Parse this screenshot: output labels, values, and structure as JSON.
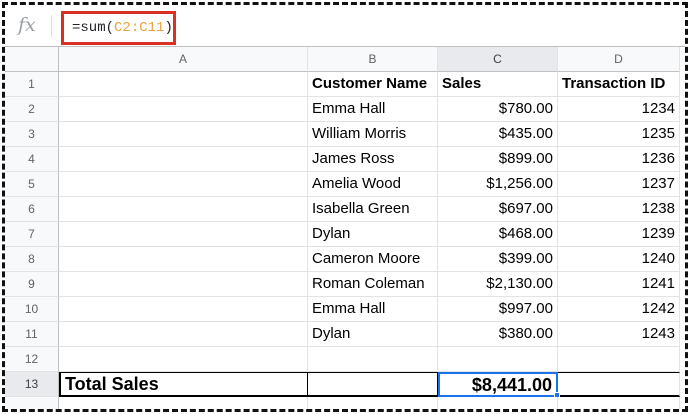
{
  "formula_bar": {
    "fx_label": "fx",
    "formula_prefix": "=sum(",
    "formula_range": "C2:C11",
    "formula_suffix": ")"
  },
  "columns": [
    "A",
    "B",
    "C",
    "D"
  ],
  "selected_column": "C",
  "selected_row": "13",
  "headers": {
    "customer_name": "Customer Name",
    "sales": "Sales",
    "transaction_id": "Transaction ID"
  },
  "rows": [
    {
      "num": "2",
      "name": "Emma Hall",
      "sales": "$780.00",
      "tid": "1234"
    },
    {
      "num": "3",
      "name": "William Morris",
      "sales": "$435.00",
      "tid": "1235"
    },
    {
      "num": "4",
      "name": "James Ross",
      "sales": "$899.00",
      "tid": "1236"
    },
    {
      "num": "5",
      "name": "Amelia Wood",
      "sales": "$1,256.00",
      "tid": "1237"
    },
    {
      "num": "6",
      "name": "Isabella Green",
      "sales": "$697.00",
      "tid": "1238"
    },
    {
      "num": "7",
      "name": "Dylan",
      "sales": "$468.00",
      "tid": "1239"
    },
    {
      "num": "8",
      "name": "Cameron Moore",
      "sales": "$399.00",
      "tid": "1240"
    },
    {
      "num": "9",
      "name": "Roman Coleman",
      "sales": "$2,130.00",
      "tid": "1241"
    },
    {
      "num": "10",
      "name": "Emma Hall",
      "sales": "$997.00",
      "tid": "1242"
    },
    {
      "num": "11",
      "name": "Dylan",
      "sales": "$380.00",
      "tid": "1243"
    }
  ],
  "row_numbers": {
    "header": "1",
    "blank": "12",
    "total": "13"
  },
  "total": {
    "label": "Total Sales",
    "value": "$8,441.00"
  },
  "colors": {
    "selection": "#1a73e8",
    "highlight_box": "#d93025",
    "range_text": "#e8a33d"
  }
}
